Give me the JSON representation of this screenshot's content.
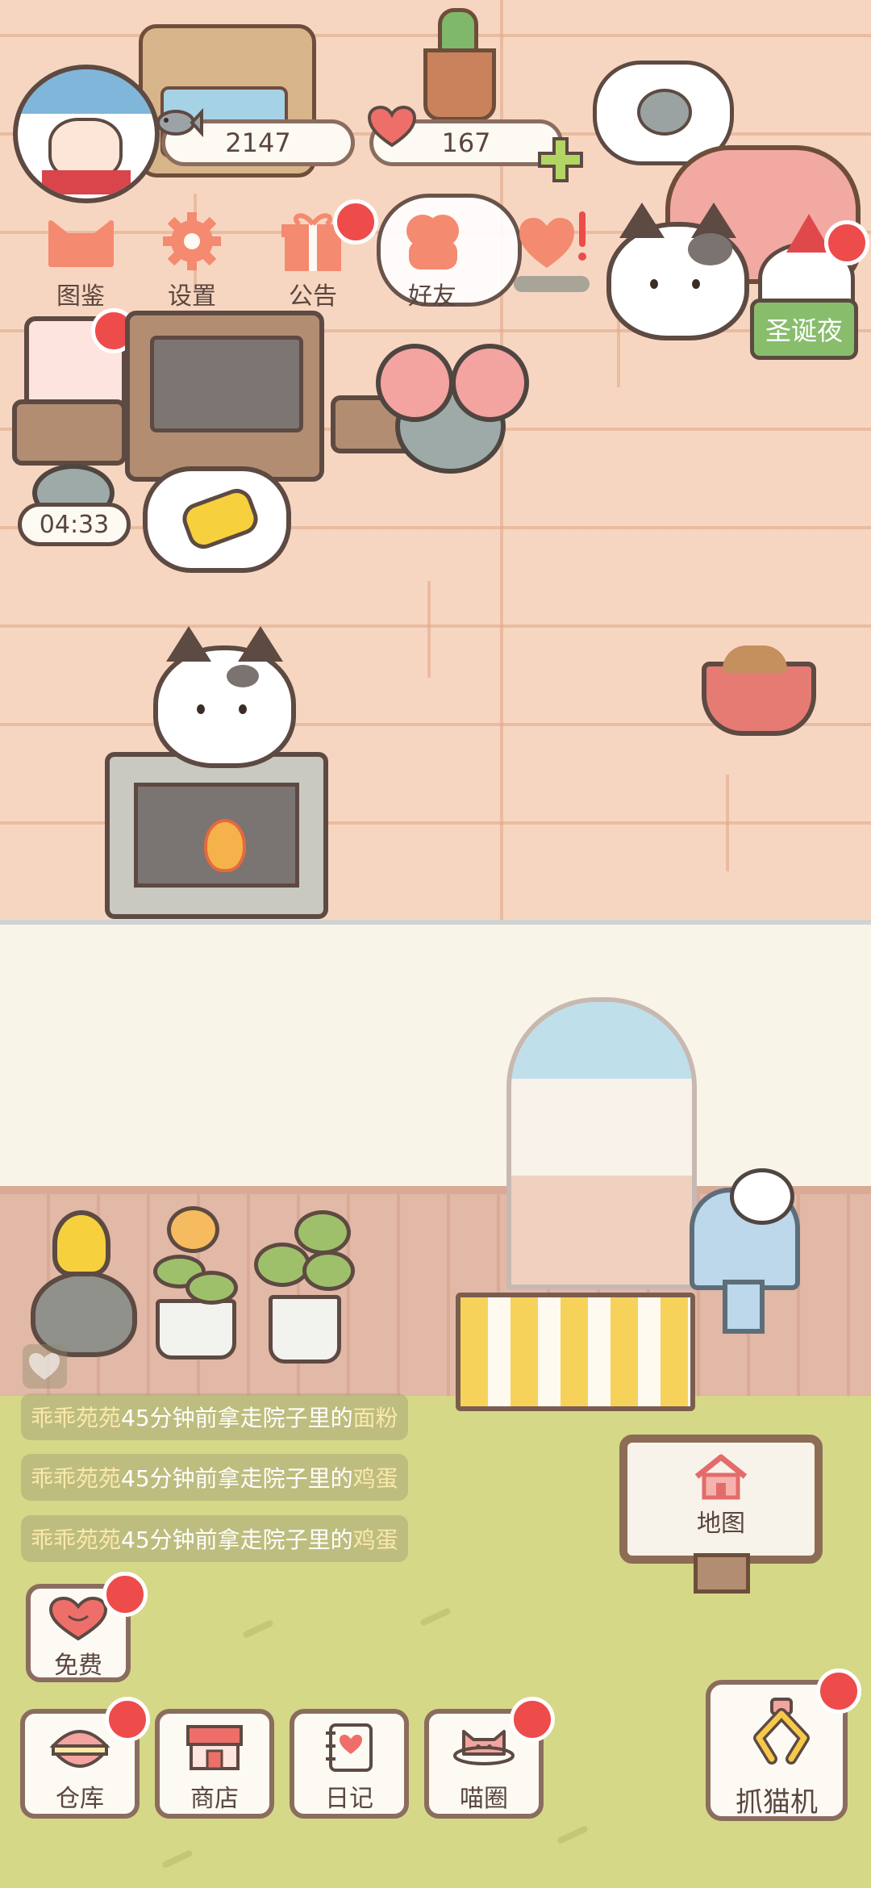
{
  "currencies": {
    "fish": "2147",
    "hearts": "167"
  },
  "top_menu": [
    {
      "id": "catalog",
      "label": "图鉴",
      "icon": "cat-face-icon",
      "badge": false
    },
    {
      "id": "settings",
      "label": "设置",
      "icon": "gear-icon",
      "badge": false
    },
    {
      "id": "notice",
      "label": "公告",
      "icon": "gift-icon",
      "badge": true
    },
    {
      "id": "friends",
      "label": "好友",
      "icon": "friends-icon",
      "badge": false
    },
    {
      "id": "likes",
      "label": "",
      "icon": "heart-exclaim-icon",
      "badge": true
    }
  ],
  "event_tag": "圣诞夜",
  "timer": "04:33",
  "feed": [
    {
      "user": "乖乖苑苑",
      "text": "45分钟前拿走院子里的",
      "item": "面粉"
    },
    {
      "user": "乖乖苑苑",
      "text": "45分钟前拿走院子里的",
      "item": "鸡蛋"
    },
    {
      "user": "乖乖苑苑",
      "text": "45分钟前拿走院子里的",
      "item": "鸡蛋"
    }
  ],
  "map_sign": {
    "label": "地图",
    "icon": "house-icon"
  },
  "free_button": {
    "label": "免费",
    "icon": "heart-icon",
    "badge": true
  },
  "bottom_nav": [
    {
      "id": "warehouse",
      "label": "仓库",
      "icon": "bowl-icon",
      "badge": true
    },
    {
      "id": "shop",
      "label": "商店",
      "icon": "shop-icon",
      "badge": false
    },
    {
      "id": "diary",
      "label": "日记",
      "icon": "diary-icon",
      "badge": false
    },
    {
      "id": "circle",
      "label": "喵圈",
      "icon": "planet-cat-icon",
      "badge": true
    }
  ],
  "claw_machine": {
    "label": "抓猫机",
    "icon": "claw-icon",
    "badge": true
  },
  "colors": {
    "outline": "#5d4a42",
    "badge_red": "#ee4b4b",
    "event_green": "#88bd6c",
    "grass": "#d5d887",
    "floor": "#f7d6c1"
  }
}
